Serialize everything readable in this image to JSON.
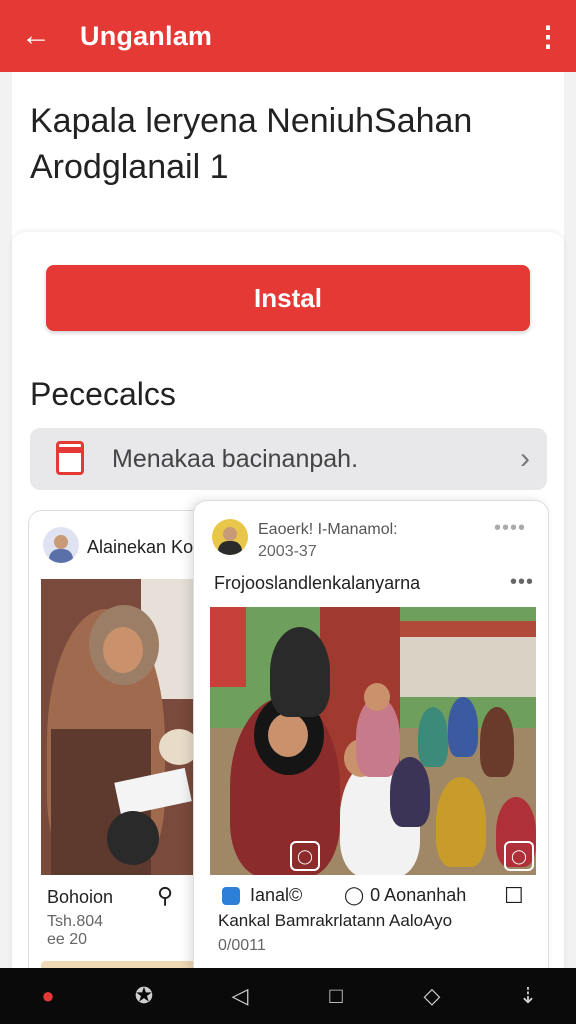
{
  "appbar": {
    "title": "Unganlam",
    "back_icon": "arrow-left-icon",
    "more_icon": "more-vert-icon"
  },
  "headline": {
    "line1": "Kapala leryena NeniuhSahan",
    "line2": "Arodglanail 1"
  },
  "install": {
    "label": "Instal"
  },
  "section": {
    "title": "Pececalcs"
  },
  "info_row": {
    "label": "Menakaa bacinanpah."
  },
  "left_post": {
    "name": "Alainekan Ko",
    "footer_label": "Bohoion",
    "meta1": "Tsh.804",
    "meta2": "ee 20"
  },
  "right_post": {
    "name": "Eaoerk! I-Manamol:",
    "time": "2003-37",
    "caption": "Frojooslandlenkalanyarna",
    "action_left": "Ianal©",
    "action_comments": "0 Aonanhah",
    "bottom_caption": "Kankal Bamrakrlatann AaloAyo",
    "bottom_time": "0/0011"
  },
  "colors": {
    "accent": "#e53935"
  }
}
